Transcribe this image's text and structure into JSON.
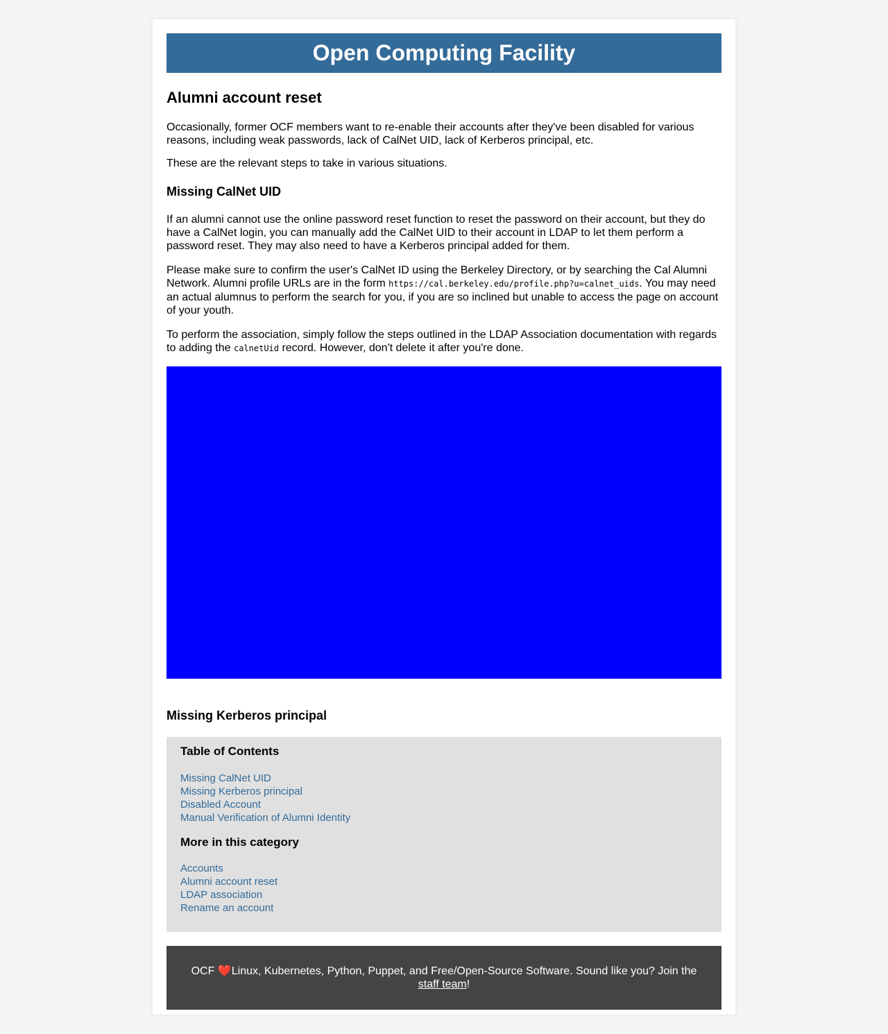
{
  "site": {
    "title": "Open Computing Facility"
  },
  "article": {
    "title": "Alumni account reset",
    "intro_1": "Occasionally, former OCF members want to re-enable their accounts after they've been disabled for various reasons, including weak passwords, lack of CalNet UID, lack of Kerberos principal, etc.",
    "intro_2": "These are the relevant steps to take in various situations.",
    "section_calnet": {
      "heading": "Missing CalNet UID",
      "para_1": "If an alumni cannot use the online password reset function to reset the password on their account, but they do have a CalNet login, you can manually add the CalNet UID to their account in LDAP to let them perform a password reset. They may also need to have a Kerberos principal added for them.",
      "para_2_before": "Please make sure to confirm the user's CalNet ID using the Berkeley Directory, or by searching the Cal Alumni Network. Alumni profile URLs are in the form ",
      "para_2_code": "https://cal.berkeley.edu/profile.php?u=calnet_uids",
      "para_2_after": ". You may need an actual alumnus to perform the search for you, if you are so inclined but unable to access the page on account of your youth.",
      "para_3_before": "To perform the association, simply follow the steps outlined in the LDAP Association documentation with regards to adding the ",
      "para_3_code": "calnetUid",
      "para_3_after": " record. However, don't delete it after you're done."
    },
    "section_kerberos": {
      "heading_prefix": "Missing ",
      "heading_link": "Kerberos principal"
    }
  },
  "sidebar": {
    "toc_heading": "Table of Contents",
    "toc_items": [
      "Missing CalNet UID",
      "Missing Kerberos principal",
      "Disabled Account",
      "Manual Verification of Alumni Identity"
    ],
    "more_heading": "More in this category",
    "more_items": [
      "Accounts",
      "Alumni account reset",
      "LDAP association",
      "Rename an account"
    ]
  },
  "footer": {
    "prefix": "OCF ",
    "heart": "❤️",
    "text": "Linux, Kubernetes, Python, Puppet, and Free/Open-Source Software. Sound like you? Join the ",
    "link": "staff team",
    "suffix": "!"
  }
}
